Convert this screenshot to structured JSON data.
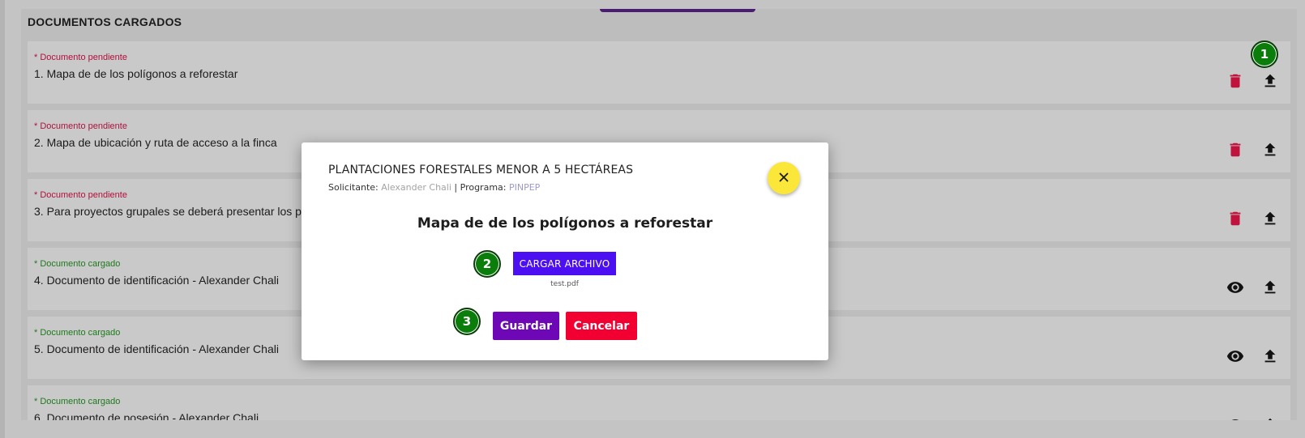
{
  "colors": {
    "pending": "#b0113d",
    "loaded": "#1d7a1d",
    "trash": "#c0123c",
    "upload_button": "#4b0ff2",
    "save_button": "#6e08b7",
    "cancel_button": "#f10031",
    "close_button": "#fbe73a",
    "step_badge": "#0b7d0b"
  },
  "section": {
    "title": "DOCUMENTOS CARGADOS"
  },
  "documents": [
    {
      "status": "* Documento pendiente",
      "name": "1. Mapa de de los polígonos a reforestar",
      "actions": [
        "trash-icon",
        "upload-icon"
      ]
    },
    {
      "status": "* Documento pendiente",
      "name": "2. Mapa de ubicación y ruta de acceso a la finca",
      "actions": [
        "trash-icon",
        "upload-icon"
      ]
    },
    {
      "status": "* Documento pendiente",
      "name": "3. Para proyectos grupales se deberá presentar los po",
      "actions": [
        "trash-icon",
        "upload-icon"
      ]
    },
    {
      "status": "* Documento cargado",
      "name": "4. Documento de identificación - Alexander Chali",
      "actions": [
        "eye-icon",
        "upload-icon"
      ]
    },
    {
      "status": "* Documento cargado",
      "name": "5. Documento de identificación - Alexander Chali",
      "actions": [
        "eye-icon",
        "upload-icon"
      ]
    },
    {
      "status": "* Documento cargado",
      "name": "6. Documento de posesión - Alexander Chali",
      "actions": [
        "eye-icon",
        "upload-icon"
      ]
    }
  ],
  "steps": {
    "one": "1",
    "two": "2",
    "three": "3"
  },
  "modal": {
    "title": "PLANTACIONES FORESTALES MENOR A 5 HECTÁREAS",
    "applicant_label": "Solicitante:",
    "applicant": "Alexander Chali",
    "separator": "|",
    "program_label": "Programa:",
    "program": "PINPEP",
    "close_icon": "close-icon",
    "document_title": "Mapa de de los polígonos a reforestar",
    "upload_label": "CARGAR ARCHIVO",
    "file_name": "test.pdf",
    "save_label": "Guardar",
    "cancel_label": "Cancelar"
  }
}
